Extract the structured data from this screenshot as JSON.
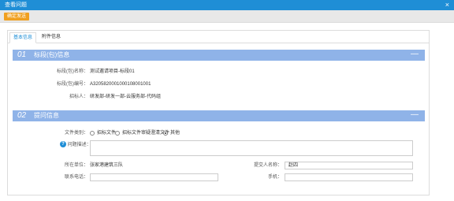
{
  "window": {
    "title": "查看问题",
    "close_glyph": "×"
  },
  "toolbar": {
    "confirm_label": "确定发送"
  },
  "tabs": [
    {
      "label": "基本信息"
    },
    {
      "label": "附件信息"
    }
  ],
  "section1": {
    "number": "01",
    "title": "标段(包)信息",
    "collapse_glyph": "—",
    "fields": [
      {
        "label": "标段(包)名称：",
        "value": "测试邀请项目-标段01"
      },
      {
        "label": "标段(包)编号：",
        "value": "A3205820001000108001001"
      },
      {
        "label": "招标人：",
        "value": "研发部-研发一部-云服务部-代码组"
      }
    ]
  },
  "section2": {
    "number": "02",
    "title": "提问信息",
    "collapse_glyph": "—",
    "file_type_label": "文件类别：",
    "file_type_options": [
      {
        "label": "招标文件",
        "checked": false
      },
      {
        "label": "招标文件审疑澄清文件",
        "checked": false
      },
      {
        "label": "其他",
        "checked": true
      }
    ],
    "description_label": "问题描述：",
    "required_mark": "*",
    "help_glyph": "?",
    "unit_label": "所在单位：",
    "unit_value": "张家港建筑三队",
    "submitter_label": "提交人名称：",
    "submitter_value": "赵四",
    "phone_label": "联系电话：",
    "phone_value": "",
    "mobile_label": "手机：",
    "mobile_value": ""
  },
  "colors": {
    "titlebar": "#1f8ed6",
    "section_header": "#8fb3e8",
    "confirm_button": "#f0a020"
  }
}
